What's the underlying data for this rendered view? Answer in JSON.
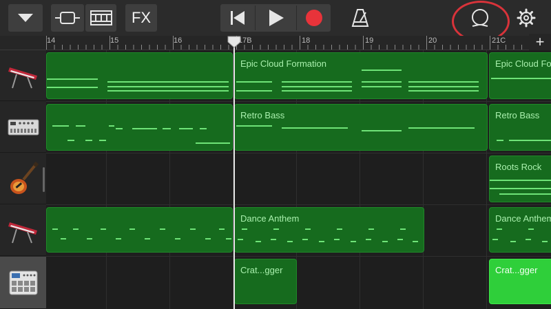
{
  "toolbar": {
    "browser_button": {
      "icon": "chevron-down-icon"
    },
    "tracks_view_button": {
      "icon": "tracks-view-icon"
    },
    "mixer_button": {
      "icon": "mixer-icon"
    },
    "fx_button": {
      "label": "FX"
    },
    "go_to_beginning_button": {
      "icon": "go-to-beginning-icon"
    },
    "play_button": {
      "icon": "play-icon"
    },
    "record_button": {
      "icon": "record-icon",
      "color": "#e8333a"
    },
    "metronome_button": {
      "icon": "metronome-icon"
    },
    "loop_browser_button": {
      "icon": "loop-icon"
    },
    "settings_button": {
      "icon": "gear-icon"
    }
  },
  "ruler": {
    "labels": [
      "14",
      "15",
      "16",
      "17B",
      "18",
      "19",
      "20",
      "21C"
    ],
    "add_section": "+"
  },
  "tracks": [
    {
      "instrument": "keyboard",
      "icon": "keyboard-synth-icon"
    },
    {
      "instrument": "bass synth",
      "icon": "drum-machine-synth-icon"
    },
    {
      "instrument": "guitar",
      "icon": "electric-guitar-icon"
    },
    {
      "instrument": "keyboard",
      "icon": "keyboard-synth-icon"
    },
    {
      "instrument": "beat sequencer",
      "icon": "beat-pad-icon"
    }
  ],
  "regions": [
    {
      "name": ""
    },
    {
      "name": "Epic Cloud Formation"
    },
    {
      "name": "Epic Cloud Formation"
    },
    {
      "name": ""
    },
    {
      "name": "Retro Bass"
    },
    {
      "name": "Retro Bass"
    },
    {
      "name": "Roots Rock"
    },
    {
      "name": ""
    },
    {
      "name": "Dance Anthem"
    },
    {
      "name": "Dance Anthem"
    },
    {
      "name": "Crat...gger"
    },
    {
      "name": "Crat...gger"
    }
  ],
  "colors": {
    "region": "#166b1e",
    "region_selected": "#2fcf3a",
    "note": "#6fe478",
    "highlight_ring": "#d8333a"
  }
}
